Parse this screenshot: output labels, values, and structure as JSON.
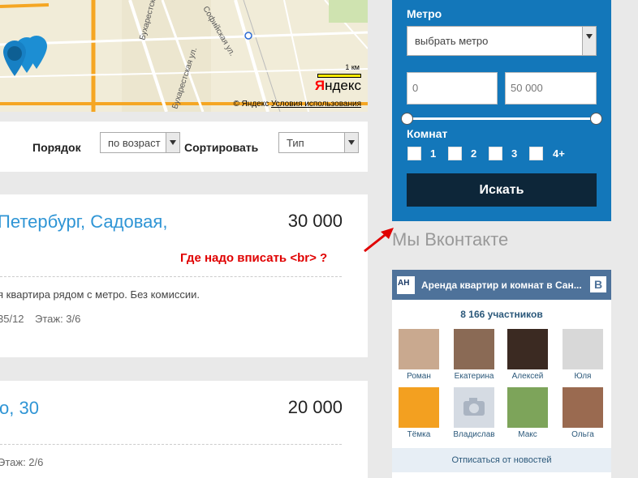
{
  "map": {
    "streets": [
      "Бухарестская ул.",
      "Софийская ул.",
      "Бухарестская ул."
    ],
    "scale": "1 км",
    "logo_prefix": "Я",
    "logo_rest": "ндекс",
    "copyright": "© Яндекс",
    "terms_link": "Условия использования"
  },
  "sort": {
    "order_label": "Порядок",
    "order_value": "по возраст",
    "sort_label": "Сортировать",
    "type_value": "Тип"
  },
  "listings": [
    {
      "title": "Петербург, Садовая,",
      "price": "30 000",
      "description": "я квартира рядом с метро. Без комиссии.",
      "meta_date": "35/12",
      "meta_floor": "Этаж: 3/6"
    },
    {
      "title": "о, 30",
      "price": "20 000",
      "meta_floor": "Этаж: 2/6"
    }
  ],
  "annotation": "Где надо вписать <br> ?",
  "filter": {
    "metro_label": "Метро",
    "metro_select": "выбрать метро",
    "price_from": "0",
    "price_to": "50 000",
    "rooms_label": "Комнат",
    "rooms": [
      "1",
      "2",
      "3",
      "4+"
    ],
    "search_button": "Искать"
  },
  "vk": {
    "heading": "Мы Вконтакте",
    "group_name": "Аренда квартир и комнат в Сан...",
    "badge": "В",
    "members": "8 166 участников",
    "people": [
      {
        "name": "Роман",
        "color": "#c9a98f"
      },
      {
        "name": "Екатерина",
        "color": "#8a6a55"
      },
      {
        "name": "Алексей",
        "color": "#3b2a22"
      },
      {
        "name": "Юля",
        "color": "#d8d8d8"
      },
      {
        "name": "Тёмка",
        "color": "#f3a020"
      },
      {
        "name": "Владислав",
        "color": "#d5dbe3"
      },
      {
        "name": "Макс",
        "color": "#7da45a"
      },
      {
        "name": "Ольга",
        "color": "#9a6a50"
      }
    ],
    "unsubscribe": "Отписаться от новостей"
  },
  "colors": {
    "panel_blue": "#1377ba",
    "search_btn": "#0d2639",
    "link_blue": "#2f95d5",
    "annotation_red": "#e00000"
  }
}
